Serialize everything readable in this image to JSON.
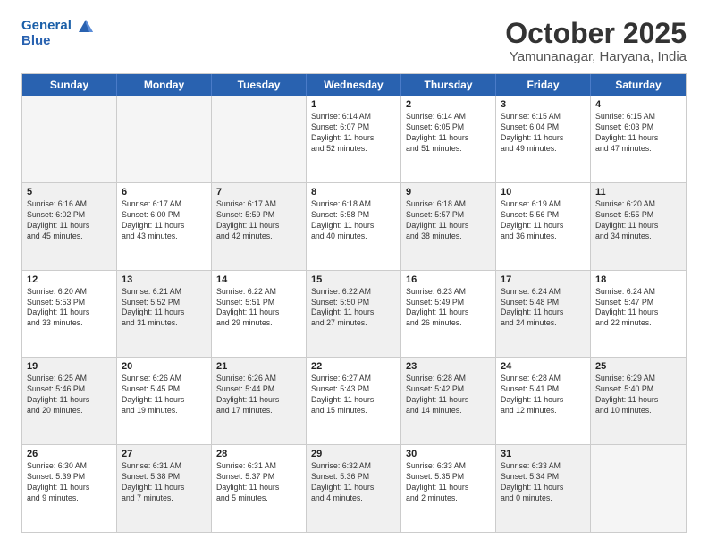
{
  "header": {
    "logo_line1": "General",
    "logo_line2": "Blue",
    "month": "October 2025",
    "location": "Yamunanagar, Haryana, India"
  },
  "weekdays": [
    "Sunday",
    "Monday",
    "Tuesday",
    "Wednesday",
    "Thursday",
    "Friday",
    "Saturday"
  ],
  "rows": [
    [
      {
        "day": "",
        "text": "",
        "empty": true
      },
      {
        "day": "",
        "text": "",
        "empty": true
      },
      {
        "day": "",
        "text": "",
        "empty": true
      },
      {
        "day": "1",
        "text": "Sunrise: 6:14 AM\nSunset: 6:07 PM\nDaylight: 11 hours\nand 52 minutes."
      },
      {
        "day": "2",
        "text": "Sunrise: 6:14 AM\nSunset: 6:05 PM\nDaylight: 11 hours\nand 51 minutes."
      },
      {
        "day": "3",
        "text": "Sunrise: 6:15 AM\nSunset: 6:04 PM\nDaylight: 11 hours\nand 49 minutes."
      },
      {
        "day": "4",
        "text": "Sunrise: 6:15 AM\nSunset: 6:03 PM\nDaylight: 11 hours\nand 47 minutes."
      }
    ],
    [
      {
        "day": "5",
        "text": "Sunrise: 6:16 AM\nSunset: 6:02 PM\nDaylight: 11 hours\nand 45 minutes.",
        "shaded": true
      },
      {
        "day": "6",
        "text": "Sunrise: 6:17 AM\nSunset: 6:00 PM\nDaylight: 11 hours\nand 43 minutes."
      },
      {
        "day": "7",
        "text": "Sunrise: 6:17 AM\nSunset: 5:59 PM\nDaylight: 11 hours\nand 42 minutes.",
        "shaded": true
      },
      {
        "day": "8",
        "text": "Sunrise: 6:18 AM\nSunset: 5:58 PM\nDaylight: 11 hours\nand 40 minutes."
      },
      {
        "day": "9",
        "text": "Sunrise: 6:18 AM\nSunset: 5:57 PM\nDaylight: 11 hours\nand 38 minutes.",
        "shaded": true
      },
      {
        "day": "10",
        "text": "Sunrise: 6:19 AM\nSunset: 5:56 PM\nDaylight: 11 hours\nand 36 minutes."
      },
      {
        "day": "11",
        "text": "Sunrise: 6:20 AM\nSunset: 5:55 PM\nDaylight: 11 hours\nand 34 minutes.",
        "shaded": true
      }
    ],
    [
      {
        "day": "12",
        "text": "Sunrise: 6:20 AM\nSunset: 5:53 PM\nDaylight: 11 hours\nand 33 minutes."
      },
      {
        "day": "13",
        "text": "Sunrise: 6:21 AM\nSunset: 5:52 PM\nDaylight: 11 hours\nand 31 minutes.",
        "shaded": true
      },
      {
        "day": "14",
        "text": "Sunrise: 6:22 AM\nSunset: 5:51 PM\nDaylight: 11 hours\nand 29 minutes."
      },
      {
        "day": "15",
        "text": "Sunrise: 6:22 AM\nSunset: 5:50 PM\nDaylight: 11 hours\nand 27 minutes.",
        "shaded": true
      },
      {
        "day": "16",
        "text": "Sunrise: 6:23 AM\nSunset: 5:49 PM\nDaylight: 11 hours\nand 26 minutes."
      },
      {
        "day": "17",
        "text": "Sunrise: 6:24 AM\nSunset: 5:48 PM\nDaylight: 11 hours\nand 24 minutes.",
        "shaded": true
      },
      {
        "day": "18",
        "text": "Sunrise: 6:24 AM\nSunset: 5:47 PM\nDaylight: 11 hours\nand 22 minutes."
      }
    ],
    [
      {
        "day": "19",
        "text": "Sunrise: 6:25 AM\nSunset: 5:46 PM\nDaylight: 11 hours\nand 20 minutes.",
        "shaded": true
      },
      {
        "day": "20",
        "text": "Sunrise: 6:26 AM\nSunset: 5:45 PM\nDaylight: 11 hours\nand 19 minutes."
      },
      {
        "day": "21",
        "text": "Sunrise: 6:26 AM\nSunset: 5:44 PM\nDaylight: 11 hours\nand 17 minutes.",
        "shaded": true
      },
      {
        "day": "22",
        "text": "Sunrise: 6:27 AM\nSunset: 5:43 PM\nDaylight: 11 hours\nand 15 minutes."
      },
      {
        "day": "23",
        "text": "Sunrise: 6:28 AM\nSunset: 5:42 PM\nDaylight: 11 hours\nand 14 minutes.",
        "shaded": true
      },
      {
        "day": "24",
        "text": "Sunrise: 6:28 AM\nSunset: 5:41 PM\nDaylight: 11 hours\nand 12 minutes."
      },
      {
        "day": "25",
        "text": "Sunrise: 6:29 AM\nSunset: 5:40 PM\nDaylight: 11 hours\nand 10 minutes.",
        "shaded": true
      }
    ],
    [
      {
        "day": "26",
        "text": "Sunrise: 6:30 AM\nSunset: 5:39 PM\nDaylight: 11 hours\nand 9 minutes."
      },
      {
        "day": "27",
        "text": "Sunrise: 6:31 AM\nSunset: 5:38 PM\nDaylight: 11 hours\nand 7 minutes.",
        "shaded": true
      },
      {
        "day": "28",
        "text": "Sunrise: 6:31 AM\nSunset: 5:37 PM\nDaylight: 11 hours\nand 5 minutes."
      },
      {
        "day": "29",
        "text": "Sunrise: 6:32 AM\nSunset: 5:36 PM\nDaylight: 11 hours\nand 4 minutes.",
        "shaded": true
      },
      {
        "day": "30",
        "text": "Sunrise: 6:33 AM\nSunset: 5:35 PM\nDaylight: 11 hours\nand 2 minutes."
      },
      {
        "day": "31",
        "text": "Sunrise: 6:33 AM\nSunset: 5:34 PM\nDaylight: 11 hours\nand 0 minutes.",
        "shaded": true
      },
      {
        "day": "",
        "text": "",
        "empty": true
      }
    ]
  ]
}
